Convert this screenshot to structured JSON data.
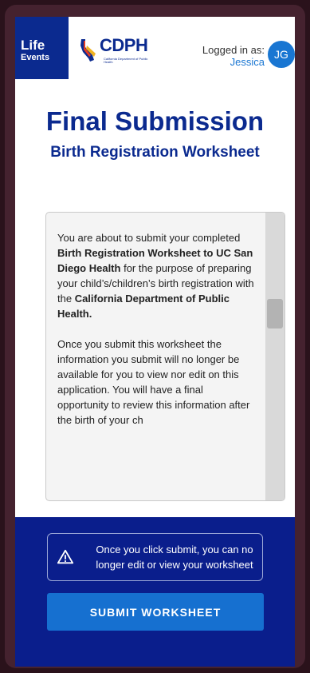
{
  "header": {
    "brand_line1": "Life",
    "brand_line2": "Events",
    "logo_text": "CDPH",
    "logo_subtext": "California Department of Public Health",
    "login_label": "Logged in as:",
    "login_user": "Jessica",
    "avatar_initials": "JG"
  },
  "main": {
    "title": "Final Submission",
    "subtitle": "Birth Registration Worksheet"
  },
  "disclosure": {
    "p1_part1": "You are about to submit your completed ",
    "p1_bold1": "Birth Registration Worksheet to UC San Diego Health",
    "p1_part2": " for the purpose of preparing your child’s/children’s birth registration with the ",
    "p1_bold2": "California Department of Public Health.",
    "p2": "Once you submit this worksheet the information you submit will no longer be available for you to view nor edit on this application.  You will have a final opportunity to review this information after the birth of your ch"
  },
  "footer": {
    "notice_text": "Once you click submit, you can no longer edit or view your worksheet",
    "submit_label": "SUBMIT WORKSHEET"
  },
  "colors": {
    "brand_blue": "#0b2a8f",
    "footer_blue": "#0a1e8c",
    "accent_blue": "#1976d2",
    "button_blue": "#1670d0"
  }
}
